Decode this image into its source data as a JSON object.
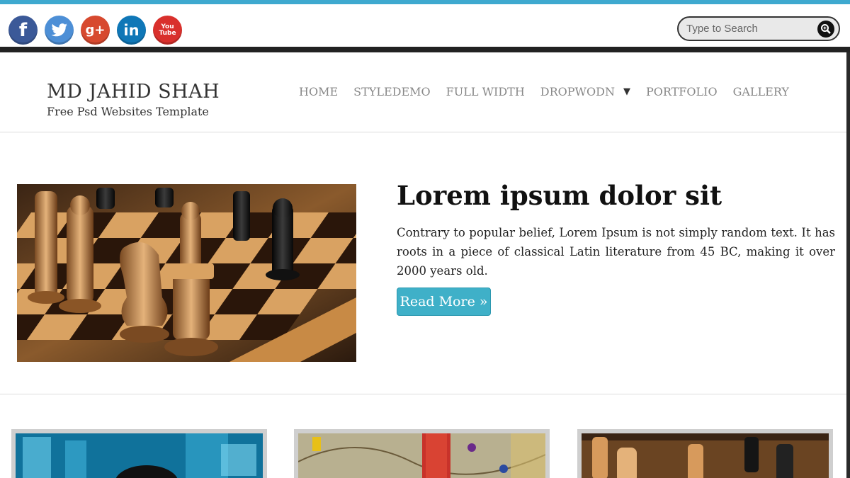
{
  "search": {
    "placeholder": "Type to Search"
  },
  "social": [
    {
      "icon": "facebook-icon",
      "glyph": "f",
      "color": "#3b5998"
    },
    {
      "icon": "twitter-icon",
      "glyph": "",
      "color": "#4d8fd6"
    },
    {
      "icon": "google-plus-icon",
      "glyph": "g+",
      "color": "#d7492f"
    },
    {
      "icon": "linkedin-icon",
      "glyph": "in",
      "color": "#0f77b7"
    },
    {
      "icon": "youtube-icon",
      "glyph": "You Tube",
      "color": "#d9302c"
    }
  ],
  "brand": {
    "title": "MD JAHID SHAH",
    "subtitle": "Free Psd Websites Template"
  },
  "nav": {
    "items": [
      {
        "label": "HOME"
      },
      {
        "label": "STYLEDEMO"
      },
      {
        "label": "FULL WIDTH"
      },
      {
        "label": "DROPWODN",
        "arrow": "▼"
      },
      {
        "label": "PORTFOLIO"
      },
      {
        "label": "GALLERY"
      }
    ]
  },
  "feature": {
    "title": "Lorem ipsum dolor sit",
    "text": "Contrary to popular belief, Lorem Ipsum is not simply random text. It has roots in a piece of classical Latin literature from 45 BC, making it over 2000 years old.",
    "button": "Read More »"
  },
  "colors": {
    "accent": "#3fb0c8",
    "topline": "#3ea9cf",
    "dark": "#222222"
  }
}
